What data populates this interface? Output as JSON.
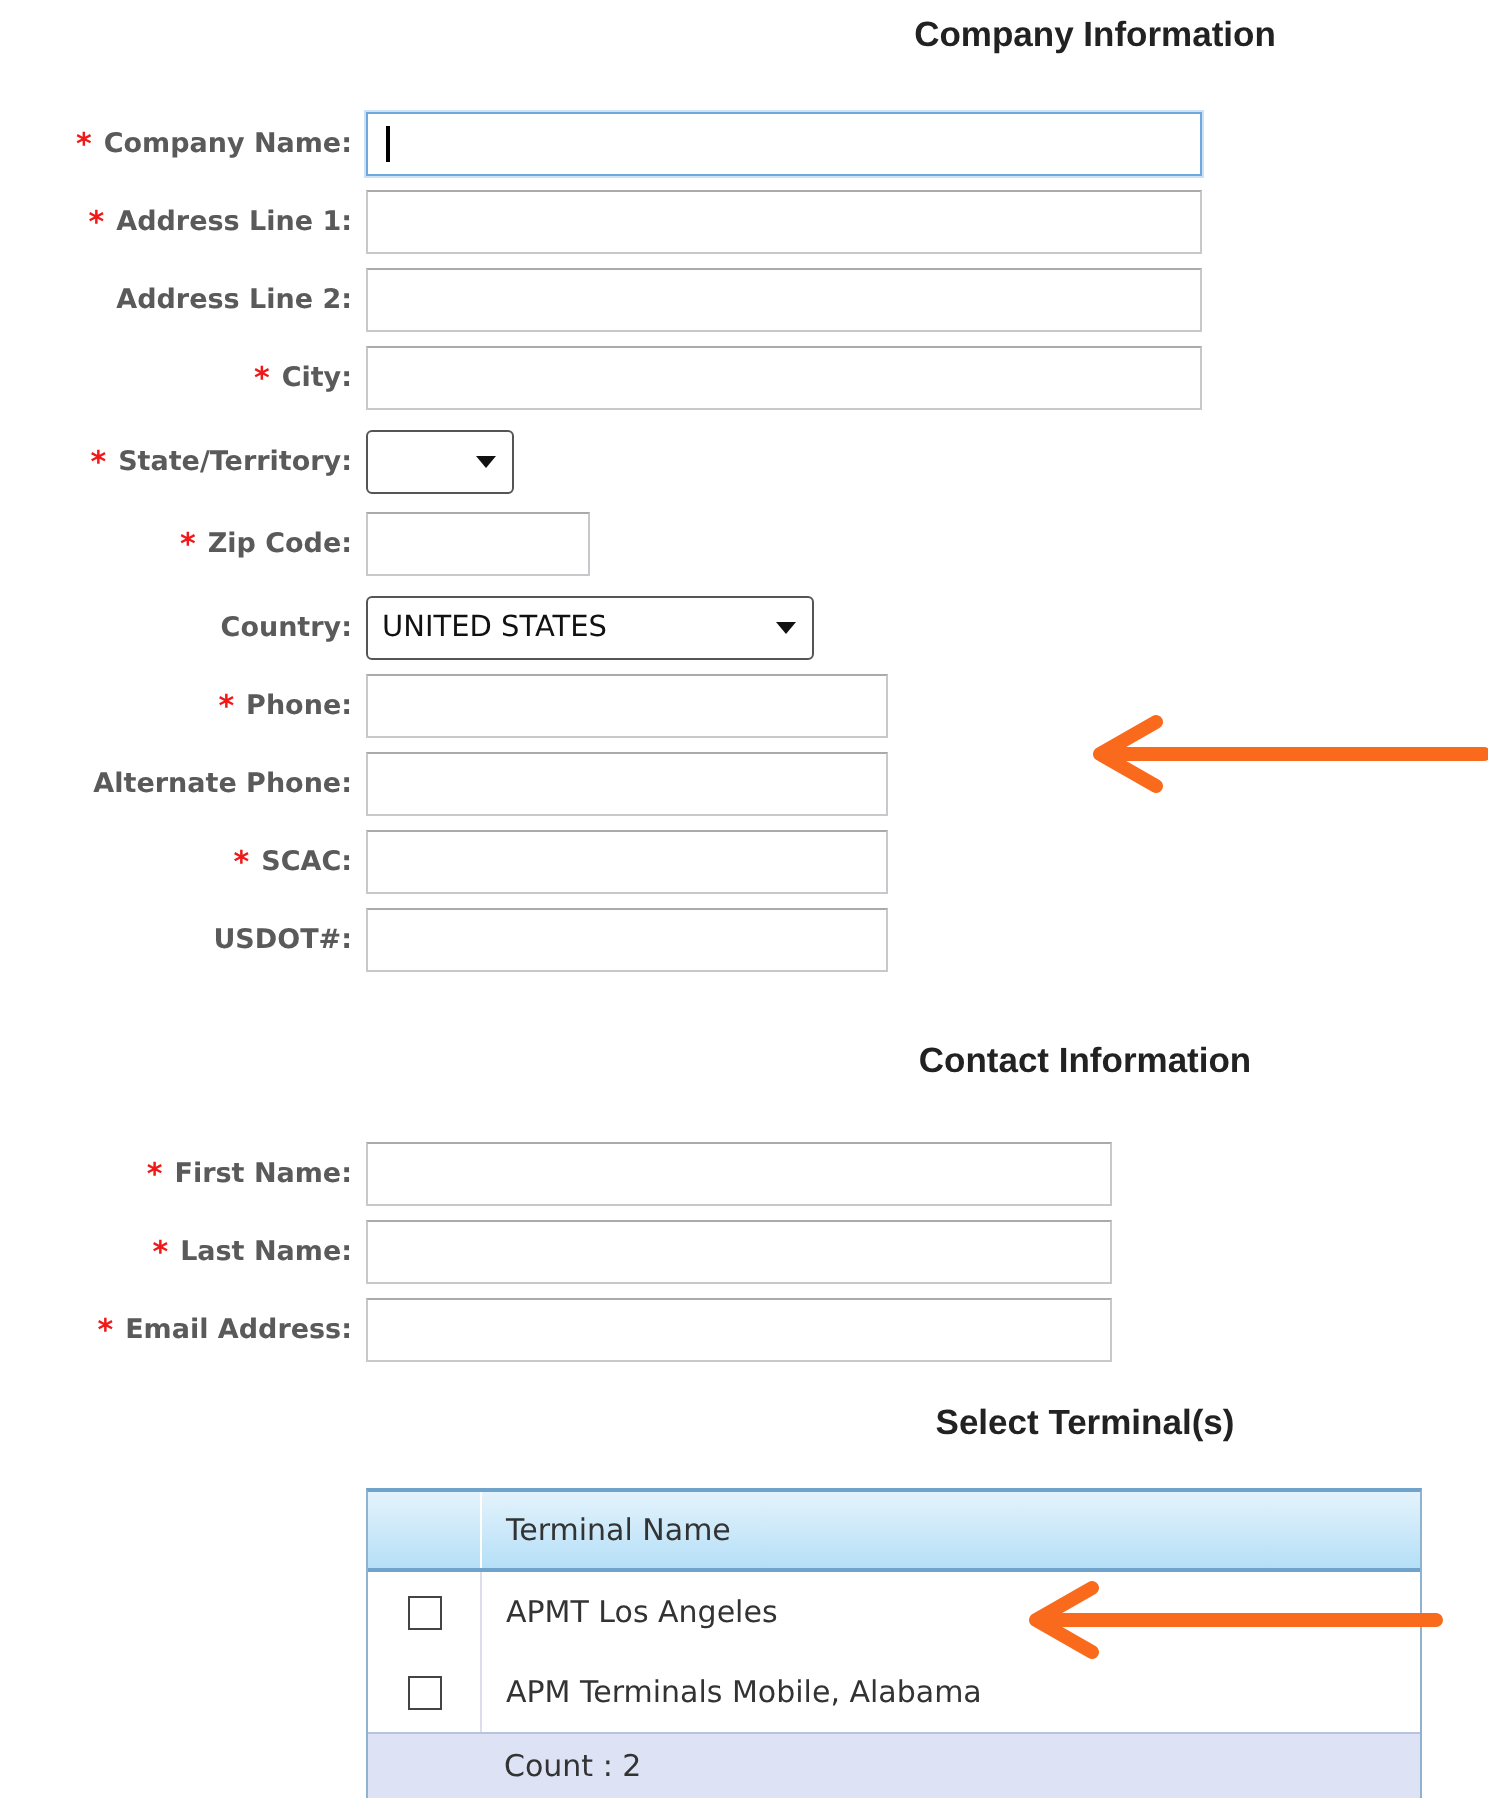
{
  "sections": [
    {
      "heading": "Company Information",
      "fields": [
        {
          "label": "Company Name:",
          "required": true,
          "kind": "text",
          "focused": true
        },
        {
          "label": "Address Line 1:",
          "required": true,
          "kind": "text",
          "focused": false
        },
        {
          "label": "Address Line 2:",
          "required": false,
          "kind": "text",
          "focused": false
        },
        {
          "label": "City:",
          "required": true,
          "kind": "text",
          "focused": false
        },
        {
          "label": "State/Territory:",
          "required": true,
          "kind": "select"
        },
        {
          "label": "Zip Code:",
          "required": true,
          "kind": "text",
          "focused": false
        },
        {
          "label": "Country:",
          "required": false,
          "kind": "select",
          "value": "UNITED STATES"
        },
        {
          "label": "Phone:",
          "required": true,
          "kind": "text",
          "focused": false
        },
        {
          "label": "Alternate Phone:",
          "required": false,
          "kind": "text",
          "focused": false
        },
        {
          "label": "SCAC:",
          "required": true,
          "kind": "text",
          "focused": false
        },
        {
          "label": "USDOT#:",
          "required": false,
          "kind": "text",
          "focused": false
        }
      ]
    },
    {
      "heading": "Contact Information",
      "fields": [
        {
          "label": "First Name:",
          "required": true,
          "kind": "text",
          "focused": false
        },
        {
          "label": "Last Name:",
          "required": true,
          "kind": "text",
          "focused": false
        },
        {
          "label": "Email Address:",
          "required": true,
          "kind": "text",
          "focused": false
        }
      ]
    }
  ],
  "required_mark": "*",
  "terminals": {
    "heading": "Select Terminal(s)",
    "column": "Terminal Name",
    "rows": [
      {
        "name": "APMT Los Angeles",
        "checked": false
      },
      {
        "name": "APM Terminals Mobile, Alabama",
        "checked": false
      }
    ],
    "footer": "Count : 2"
  }
}
